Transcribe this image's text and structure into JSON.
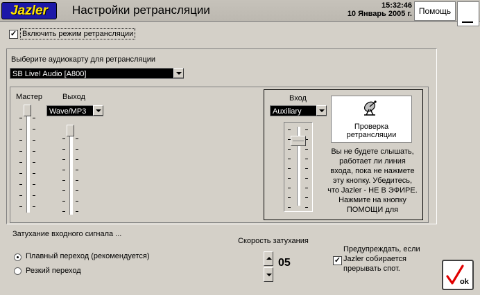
{
  "header": {
    "logo": "Jazler",
    "title": "Настройки ретрансляции",
    "time": "15:32:46",
    "date": "10 Январь 2005 г.",
    "help_label": "Помощь"
  },
  "enable_relay": {
    "label": "Включить режим ретрансляции",
    "checked": true
  },
  "soundcard": {
    "label": "Выберите аудиокарту для  ретрансляции",
    "value": "SB Live! Audio [A800]"
  },
  "mixer": {
    "master_label": "Мастер",
    "output_label": "Выход",
    "output_value": "Wave/MP3",
    "master_level": 1.0,
    "output_level": 1.0
  },
  "input": {
    "label": "Вход",
    "value": "Auxiliary",
    "level": 0.85,
    "test_button_label": "Проверка\nретрансляции",
    "hint": "Вы не будете слышать,\nработает ли линия\nвхода, пока не нажмете\nэту кнопку. Убедитесь,\nчто Jazler - НЕ В ЭФИРЕ.\nНажмите на кнопку\nПОМОЩИ для"
  },
  "fade": {
    "label": "Затухание входного сигнала ...",
    "option_smooth": "Плавный переход (рекомендуется)",
    "option_sharp": "Резкий переход",
    "selected": "smooth"
  },
  "speed": {
    "label": "Скорость затухания",
    "value": "05"
  },
  "warn": {
    "label": "Предупреждать, если\nJazler собирается\nпрерывать спот.",
    "checked": true
  },
  "ok_label": "ok"
}
